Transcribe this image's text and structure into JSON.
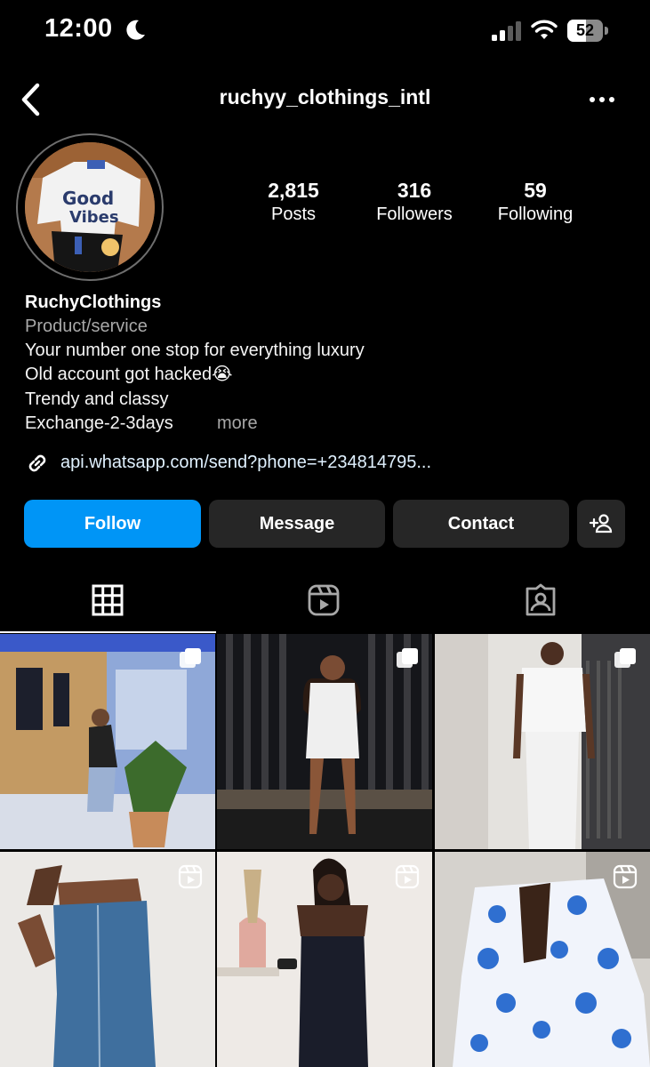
{
  "status_bar": {
    "time": "12:00",
    "battery": "52",
    "battery_level": 0.52
  },
  "header": {
    "username": "ruchyy_clothings_intl"
  },
  "stats": [
    {
      "value": "2,815",
      "label": "Posts"
    },
    {
      "value": "316",
      "label": "Followers"
    },
    {
      "value": "59",
      "label": "Following"
    }
  ],
  "bio": {
    "name": "RuchyClothings",
    "category": "Product/service",
    "lines": [
      "Your number one stop for everything luxury",
      "Old account got hacked😭",
      "Trendy and classy",
      "Exchange-2-3days"
    ],
    "more": "more",
    "link": "api.whatsapp.com/send?phone=+234814795..."
  },
  "buttons": {
    "follow": "Follow",
    "message": "Message",
    "contact": "Contact"
  },
  "tabs": [
    {
      "icon": "grid-icon",
      "active": true
    },
    {
      "icon": "reels-icon",
      "active": false
    },
    {
      "icon": "tagged-icon",
      "active": false
    }
  ],
  "grid": [
    {
      "type": "carousel",
      "icon": "multiple-posts-icon"
    },
    {
      "type": "carousel",
      "icon": "multiple-posts-icon"
    },
    {
      "type": "carousel",
      "icon": "multiple-posts-icon"
    },
    {
      "type": "reel",
      "icon": "reel-icon"
    },
    {
      "type": "reel",
      "icon": "reel-icon"
    },
    {
      "type": "reel",
      "icon": "reel-icon"
    }
  ],
  "colors": {
    "follow": "#0095f6",
    "secondary_button": "#262626",
    "muted_text": "#a8a8a8"
  }
}
